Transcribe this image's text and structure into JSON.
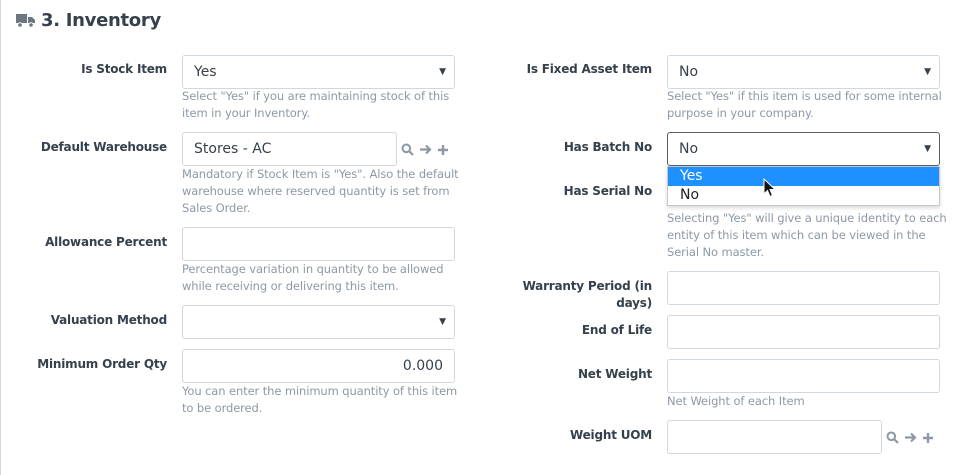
{
  "section": {
    "title": "3. Inventory",
    "icon": "truck-icon"
  },
  "left": {
    "is_stock_item": {
      "label": "Is Stock Item",
      "value": "Yes",
      "help": [
        "Select \"Yes\" if you are maintaining stock of this",
        "item in your Inventory."
      ]
    },
    "default_warehouse": {
      "label": "Default Warehouse",
      "value": "Stores - AC",
      "help": [
        "Mandatory if Stock Item is \"Yes\". Also the default",
        "warehouse where reserved quantity is set from",
        "Sales Order."
      ]
    },
    "allowance_percent": {
      "label": "Allowance Percent",
      "value": "",
      "help": [
        "Percentage variation in quantity to be allowed",
        "while receiving or delivering this item."
      ]
    },
    "valuation_method": {
      "label": "Valuation Method",
      "value": ""
    },
    "min_order_qty": {
      "label": "Minimum Order Qty",
      "value": "0.000",
      "help": [
        "You can enter the minimum quantity of this item",
        "to be ordered."
      ]
    }
  },
  "right": {
    "is_fixed_asset": {
      "label": "Is Fixed Asset Item",
      "value": "No",
      "help": [
        "Select \"Yes\" if this item is used for some internal",
        "purpose in your company."
      ]
    },
    "has_batch_no": {
      "label": "Has Batch No",
      "value": "No",
      "options": [
        "Yes",
        "No"
      ],
      "highlighted": "Yes"
    },
    "has_serial_no": {
      "label": "Has Serial No",
      "help": [
        "Selecting \"Yes\" will give a unique identity to each",
        "entity of this item which can be viewed in the",
        "Serial No master."
      ]
    },
    "warranty_period": {
      "label_lines": [
        "Warranty Period (in",
        "days)"
      ],
      "value": ""
    },
    "end_of_life": {
      "label": "End of Life",
      "value": ""
    },
    "net_weight": {
      "label": "Net Weight",
      "value": "",
      "help": [
        "Net Weight of each Item"
      ]
    },
    "weight_uom": {
      "label": "Weight UOM",
      "value": ""
    }
  },
  "colors": {
    "border": "#d1d8dd",
    "text": "#36414c",
    "help": "#8d99a6",
    "highlight": "#1e90ff"
  }
}
